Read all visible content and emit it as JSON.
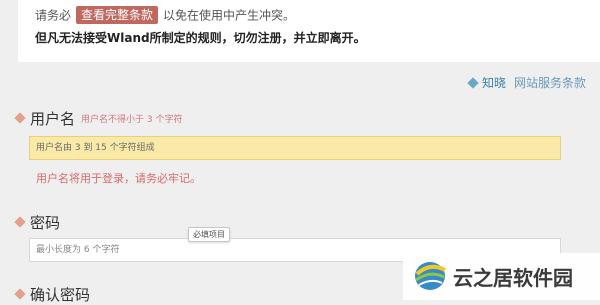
{
  "terms": {
    "prefix": "请务必",
    "button_label": "查看完整条款",
    "suffix": "以免在使用中产生冲突。",
    "warning": "但凡无法接受Wland所制定的规则，切勿注册，并立即离开。"
  },
  "agree": {
    "label": "知晓",
    "link": "网站服务条款"
  },
  "username": {
    "label": "用户名",
    "hint": "用户名不得小于 3 个字符",
    "placeholder": "用户名由 3 到 15 个字符组成",
    "note": "用户名将用于登录，请务必牢记。"
  },
  "password": {
    "label": "密码",
    "placeholder": "最小长度为 6 个字符",
    "tooltip": "必填项目"
  },
  "confirm_password": {
    "label": "确认密码"
  },
  "watermark": {
    "text": "云之居软件园"
  },
  "colors": {
    "accent_red": "#c0675f",
    "hint_red": "#d96b6b",
    "link_blue": "#3a7fae",
    "focus_yellow": "#fbe9a7"
  }
}
